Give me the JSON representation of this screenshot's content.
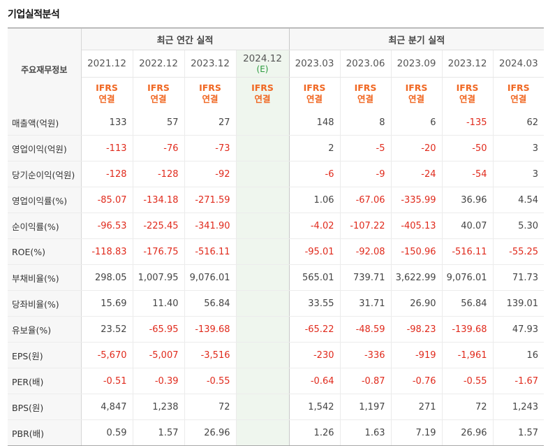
{
  "title": "기업실적분석",
  "header": {
    "row_label": "주요재무정보",
    "annual_group": "최근 연간 실적",
    "quarterly_group": "최근 분기 실적",
    "annual_periods": [
      "2021.12",
      "2022.12",
      "2023.12"
    ],
    "estimate_period": "2024.12",
    "estimate_mark": "(E)",
    "quarter_periods": [
      "2023.03",
      "2023.06",
      "2023.09",
      "2023.12",
      "2024.03"
    ],
    "ifrs_line1": "IFRS",
    "ifrs_line2": "연결"
  },
  "rows": [
    {
      "label": "매출액(억원)",
      "values": [
        "133",
        "57",
        "27",
        "",
        "148",
        "8",
        "6",
        "-135",
        "62"
      ]
    },
    {
      "label": "영업이익(억원)",
      "values": [
        "-113",
        "-76",
        "-73",
        "",
        "2",
        "-5",
        "-20",
        "-50",
        "3"
      ]
    },
    {
      "label": "당기순이익(억원)",
      "values": [
        "-128",
        "-128",
        "-92",
        "",
        "-6",
        "-9",
        "-24",
        "-54",
        "3"
      ]
    },
    {
      "label": "영업이익률(%)",
      "values": [
        "-85.07",
        "-134.18",
        "-271.59",
        "",
        "1.06",
        "-67.06",
        "-335.99",
        "36.96",
        "4.54"
      ]
    },
    {
      "label": "순이익률(%)",
      "values": [
        "-96.53",
        "-225.45",
        "-341.90",
        "",
        "-4.02",
        "-107.22",
        "-405.13",
        "40.07",
        "5.30"
      ]
    },
    {
      "label": "ROE(%)",
      "values": [
        "-118.83",
        "-176.75",
        "-516.11",
        "",
        "-95.01",
        "-92.08",
        "-150.96",
        "-516.11",
        "-55.25"
      ]
    },
    {
      "label": "부채비율(%)",
      "values": [
        "298.05",
        "1,007.95",
        "9,076.01",
        "",
        "565.01",
        "739.71",
        "3,622.99",
        "9,076.01",
        "71.73"
      ]
    },
    {
      "label": "당좌비율(%)",
      "values": [
        "15.69",
        "11.40",
        "56.84",
        "",
        "33.55",
        "31.71",
        "26.90",
        "56.84",
        "139.01"
      ]
    },
    {
      "label": "유보율(%)",
      "values": [
        "23.52",
        "-65.95",
        "-139.68",
        "",
        "-65.22",
        "-48.59",
        "-98.23",
        "-139.68",
        "47.93"
      ]
    },
    {
      "label": "EPS(원)",
      "values": [
        "-5,670",
        "-5,007",
        "-3,516",
        "",
        "-230",
        "-336",
        "-919",
        "-1,961",
        "16"
      ]
    },
    {
      "label": "PER(배)",
      "values": [
        "-0.51",
        "-0.39",
        "-0.55",
        "",
        "-0.64",
        "-0.87",
        "-0.76",
        "-0.55",
        "-1.67"
      ]
    },
    {
      "label": "BPS(원)",
      "values": [
        "4,847",
        "1,238",
        "72",
        "",
        "1,542",
        "1,197",
        "271",
        "72",
        "1,243"
      ]
    },
    {
      "label": "PBR(배)",
      "values": [
        "0.59",
        "1.57",
        "26.96",
        "",
        "1.26",
        "1.63",
        "7.19",
        "26.96",
        "1.57"
      ]
    }
  ]
}
